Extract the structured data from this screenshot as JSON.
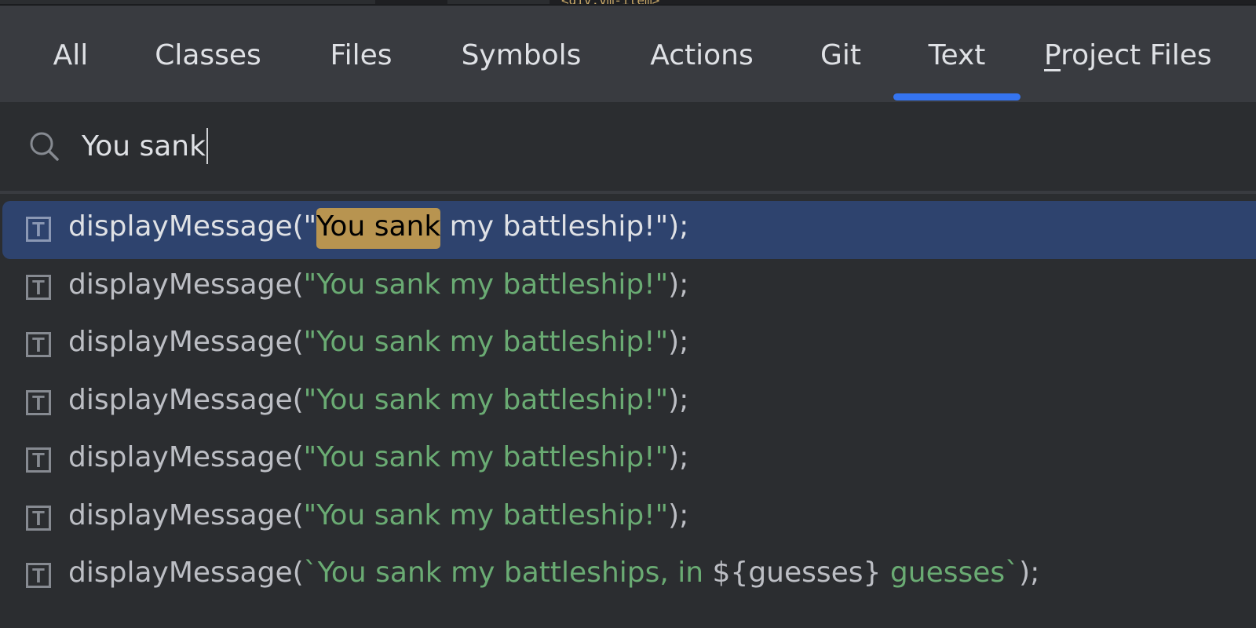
{
  "tabs": [
    {
      "label": "All",
      "active": false
    },
    {
      "label": "Classes",
      "active": false
    },
    {
      "label": "Files",
      "active": false
    },
    {
      "label": "Symbols",
      "active": false
    },
    {
      "label": "Actions",
      "active": false
    },
    {
      "label": "Git",
      "active": false
    },
    {
      "label": "Text",
      "active": true
    },
    {
      "label": "Project Files",
      "mnemonic": "P",
      "rest": "roject Files",
      "active": false
    }
  ],
  "background_code_peek": "<div:vm-item>",
  "search": {
    "icon": "search-icon",
    "value": "You sank"
  },
  "results": [
    {
      "icon": "text-file-icon",
      "prefix": "displayMessage(\"",
      "match": "You sank",
      "rest": " my battleship!\"",
      "suffix": ");",
      "selected": true
    },
    {
      "icon": "text-file-icon",
      "prefix": "displayMessage(",
      "string": "\"You sank my battleship!\"",
      "suffix": ");",
      "selected": false
    },
    {
      "icon": "text-file-icon",
      "prefix": "displayMessage(",
      "string": "\"You sank my battleship!\"",
      "suffix": ");",
      "selected": false
    },
    {
      "icon": "text-file-icon",
      "prefix": "displayMessage(",
      "string": "\"You sank my battleship!\"",
      "suffix": ");",
      "selected": false
    },
    {
      "icon": "text-file-icon",
      "prefix": "displayMessage(",
      "string": "\"You sank my battleship!\"",
      "suffix": ");",
      "selected": false
    },
    {
      "icon": "text-file-icon",
      "prefix": "displayMessage(",
      "string": "\"You sank my battleship!\"",
      "suffix": ");",
      "selected": false
    },
    {
      "icon": "text-file-icon",
      "prefix": "displayMessage(",
      "string": "`You sank my battleships, in ",
      "interp": "${guesses}",
      "string2": " guesses`",
      "suffix": ");",
      "selected": false
    }
  ],
  "colors": {
    "accent": "#3574f0",
    "selection": "#2e436e",
    "match_highlight": "#b89450",
    "string": "#6aab73"
  }
}
